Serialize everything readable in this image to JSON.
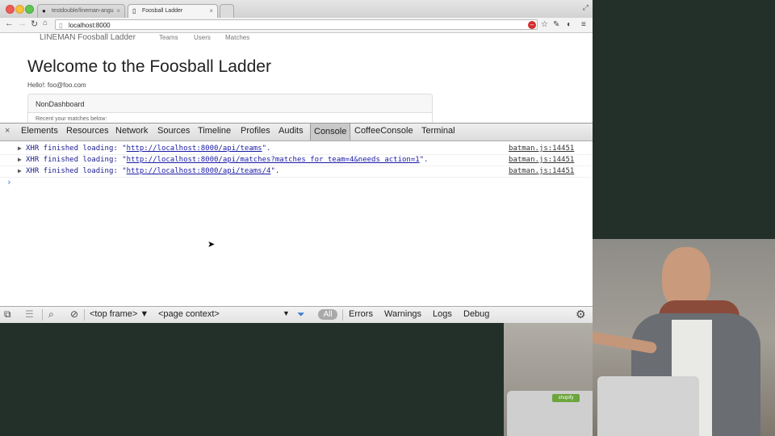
{
  "browser": {
    "tabs": [
      {
        "label": "testdouble/lineman-angu",
        "icon": "github-icon"
      },
      {
        "label": "Foosball Ladder",
        "icon": "page-icon"
      }
    ],
    "url": "localhost:8000"
  },
  "page": {
    "brand": "LINEMAN Foosball Ladder",
    "nav": [
      "Teams",
      "Users",
      "Matches"
    ],
    "heading": "Welcome to the Foosball Ladder",
    "hello": "Hello!: foo@foo.com",
    "panel_title": "NonDashboard",
    "panel_body": "Recent your matches below:"
  },
  "devtools": {
    "tabs": [
      "Elements",
      "Resources",
      "Network",
      "Sources",
      "Timeline",
      "Profiles",
      "Audits",
      "Console",
      "CoffeeConsole",
      "Terminal"
    ],
    "active_tab": "Console",
    "console_rows": [
      {
        "prefix": "XHR finished loading: \"",
        "url": "http://localhost:8000/api/teams",
        "suffix": "\".",
        "source": "batman.js:14451"
      },
      {
        "prefix": "XHR finished loading: \"",
        "url": "http://localhost:8000/api/matches?matches_for_team=4&needs_action=1",
        "suffix": "\".",
        "source": "batman.js:14451"
      },
      {
        "prefix": "XHR finished loading: \"",
        "url": "http://localhost:8000/api/teams/4",
        "suffix": "\".",
        "source": "batman.js:14451"
      }
    ],
    "prompt": "›",
    "frame_select": "<top frame>",
    "context_select": "<page context>",
    "filters": [
      "All",
      "Errors",
      "Warnings",
      "Logs",
      "Debug"
    ],
    "active_filter": "All"
  }
}
